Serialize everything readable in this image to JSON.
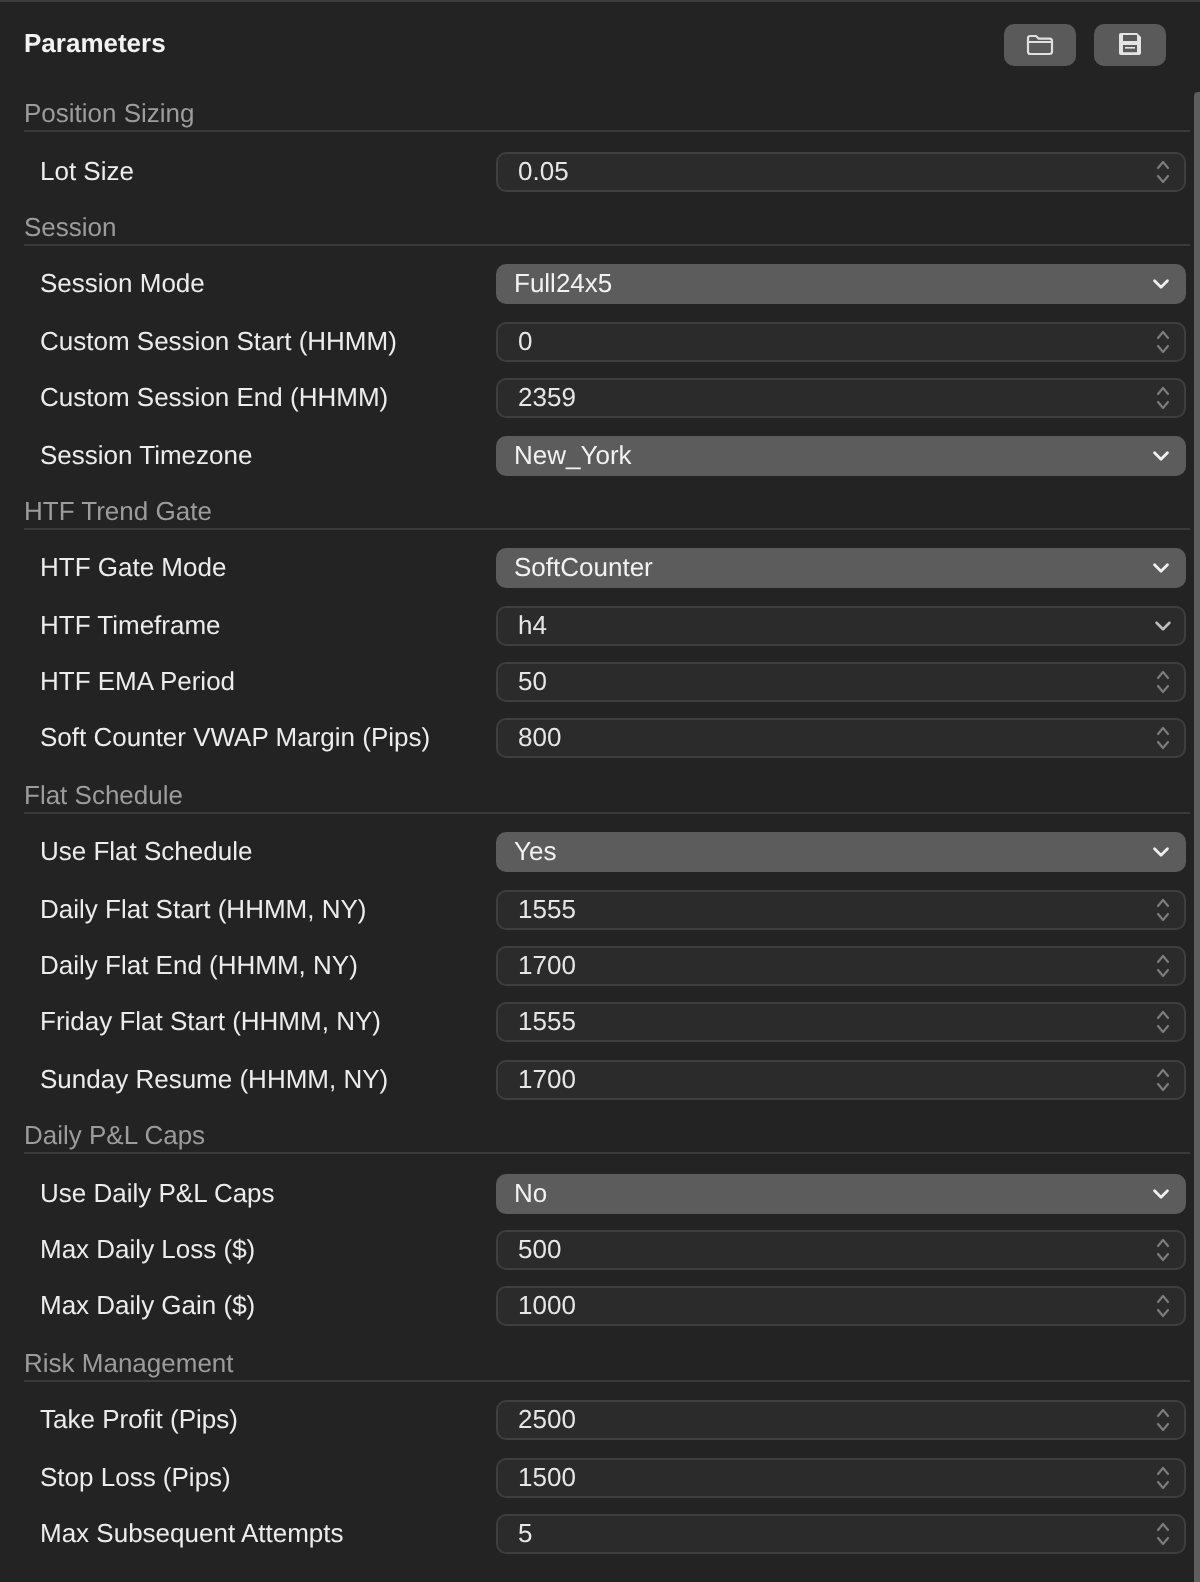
{
  "panel": {
    "title": "Parameters"
  },
  "sections": [
    {
      "title": "Position Sizing",
      "params": [
        {
          "label": "Lot Size",
          "kind": "stepper",
          "value": "0.05"
        }
      ]
    },
    {
      "title": "Session",
      "params": [
        {
          "label": "Session Mode",
          "kind": "popup",
          "value": "Full24x5"
        },
        {
          "label": "Custom Session Start (HHMM)",
          "kind": "stepper",
          "value": "0"
        },
        {
          "label": "Custom Session End (HHMM)",
          "kind": "stepper",
          "value": "2359"
        },
        {
          "label": "Session Timezone",
          "kind": "popup",
          "value": "New_York"
        }
      ]
    },
    {
      "title": "HTF Trend Gate",
      "params": [
        {
          "label": "HTF Gate Mode",
          "kind": "popup",
          "value": "SoftCounter"
        },
        {
          "label": "HTF Timeframe",
          "kind": "combo",
          "value": "h4"
        },
        {
          "label": "HTF EMA Period",
          "kind": "stepper",
          "value": "50"
        },
        {
          "label": "Soft Counter VWAP Margin (Pips)",
          "kind": "stepper",
          "value": "800"
        }
      ]
    },
    {
      "title": "Flat Schedule",
      "params": [
        {
          "label": "Use Flat Schedule",
          "kind": "popup",
          "value": "Yes"
        },
        {
          "label": "Daily Flat Start (HHMM, NY)",
          "kind": "stepper",
          "value": "1555"
        },
        {
          "label": "Daily Flat End (HHMM, NY)",
          "kind": "stepper",
          "value": "1700"
        },
        {
          "label": "Friday Flat Start (HHMM, NY)",
          "kind": "stepper",
          "value": "1555"
        },
        {
          "label": "Sunday Resume (HHMM, NY)",
          "kind": "stepper",
          "value": "1700"
        }
      ]
    },
    {
      "title": "Daily P&L Caps",
      "params": [
        {
          "label": "Use Daily P&L Caps",
          "kind": "popup",
          "value": "No"
        },
        {
          "label": "Max Daily Loss ($)",
          "kind": "stepper",
          "value": "500"
        },
        {
          "label": "Max Daily Gain ($)",
          "kind": "stepper",
          "value": "1000"
        }
      ]
    },
    {
      "title": "Risk Management",
      "params": [
        {
          "label": "Take Profit (Pips)",
          "kind": "stepper",
          "value": "2500"
        },
        {
          "label": "Stop Loss (Pips)",
          "kind": "stepper",
          "value": "1500"
        },
        {
          "label": "Max Subsequent Attempts",
          "kind": "stepper",
          "value": "5"
        }
      ]
    }
  ]
}
